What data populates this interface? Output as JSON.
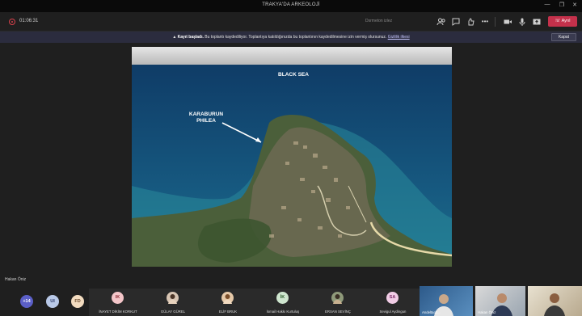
{
  "window": {
    "title": "TRAKYA'DA ARKEOLOJİ"
  },
  "meeting": {
    "timer": "01:06:31",
    "reactions_label": "Dsrmeton izlez",
    "leave_label": "Ayrıl"
  },
  "recording_banner": {
    "bold": "Kayıt başladı.",
    "text": "Bu toplantı kaydediliyor. Toplantıya katıldığınızda bu toplantının kaydedilmesine izin vermiş olursunuz.",
    "link": "Gizlilik ilkesi",
    "close_label": "Kapat"
  },
  "slide": {
    "sea_label": "BLACK SEA",
    "site_label_line1": "KARABURUN",
    "site_label_line2": "PHILEA"
  },
  "presenter_name": "Hakan Öniz",
  "participants": {
    "overflow_count": "+14",
    "chips": [
      {
        "initials": "UI",
        "color": "#b9c9e8"
      },
      {
        "initials": "FD",
        "color": "#f3dcc0"
      }
    ],
    "tiles": [
      {
        "initials": "IK",
        "name": "İNAYET DİKİM KORKUT",
        "color": "#f4c6c9",
        "photo": false
      },
      {
        "initials": "",
        "name": "GÜLAY GÜREL",
        "color": "#d9c6b4",
        "photo": true
      },
      {
        "initials": "",
        "name": "ELİF BRUK",
        "color": "#e6c9a8",
        "photo": true
      },
      {
        "initials": "İK",
        "name": "İsmail Hakkı Kurtuluş",
        "color": "#cfe6cf",
        "photo": false
      },
      {
        "initials": "",
        "name": "ERSAN SEVİNÇ",
        "color": "#8f9a7a",
        "photo": true
      },
      {
        "initials": "SA",
        "name": "Sevigul Aydingun",
        "color": "#f2cde6",
        "photo": false
      }
    ],
    "videos": [
      {
        "name": "Andeltaoz..."
      },
      {
        "name": "Hakan Öniz"
      },
      {
        "name": ""
      }
    ]
  }
}
